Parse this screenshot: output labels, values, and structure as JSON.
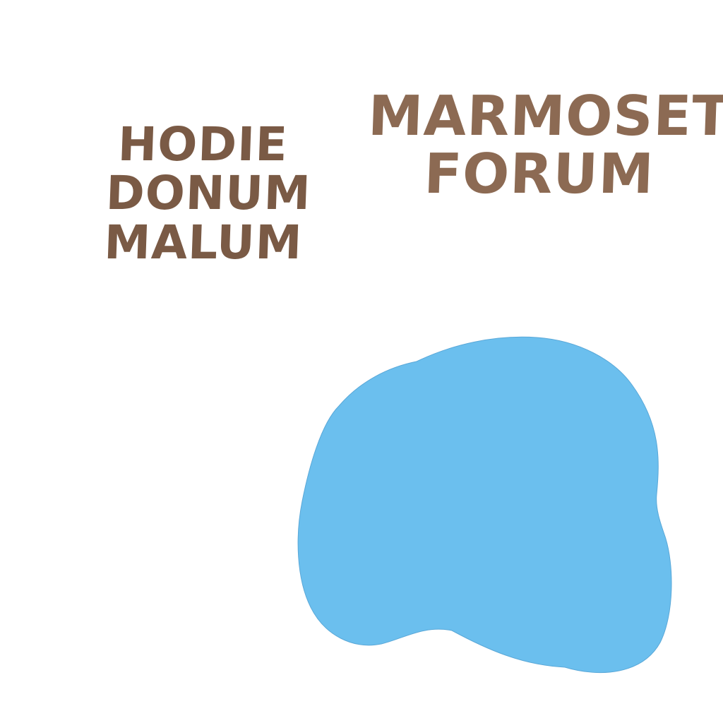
{
  "motto": {
    "lines": [
      "HODIE",
      "DONUM",
      "MALUM"
    ]
  },
  "brand": {
    "lines": [
      "MARMOSET",
      "FORUM"
    ]
  },
  "colors": {
    "motto_text": "#7a5a45",
    "brand_text": "#8c6a53",
    "blob_fill": "#6bbfee",
    "blob_stroke": "#5aa8d8",
    "background": "#ffffff"
  }
}
